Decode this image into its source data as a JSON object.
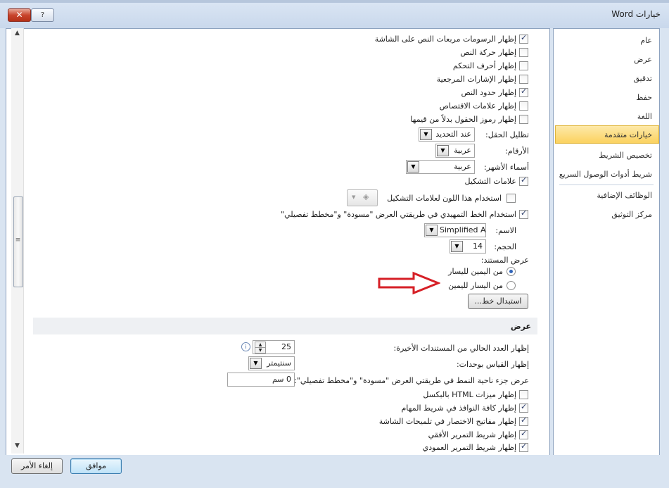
{
  "window": {
    "title": "خيارات Word",
    "close_label": "✕",
    "help_label": "?"
  },
  "nav": {
    "items": [
      {
        "label": "عام"
      },
      {
        "label": "عرض"
      },
      {
        "label": "تدقيق"
      },
      {
        "label": "حفظ"
      },
      {
        "label": "اللغة"
      },
      {
        "label": "خيارات متقدمة",
        "selected": true
      },
      {
        "label": "تخصيص الشريط"
      },
      {
        "label": "شريط أدوات الوصول السريع"
      },
      {
        "label": "الوظائف الإضافية"
      },
      {
        "label": "مركز التوثيق"
      }
    ]
  },
  "content": {
    "checkboxes_top": [
      {
        "label": "إظهار الرسومات مربعات النص على الشاشة",
        "checked": true
      },
      {
        "label": "إظهار حركة النص",
        "checked": false
      },
      {
        "label": "إظهار أحرف التحكم",
        "checked": false
      },
      {
        "label": "إظهار الإشارات المرجعية",
        "checked": false
      },
      {
        "label": "إظهار حدود النص",
        "checked": true
      },
      {
        "label": "إظهار علامات الاقتصاص",
        "checked": false
      },
      {
        "label": "إظهار رموز الحقول بدلاً من قيمها",
        "checked": false
      }
    ],
    "field_shading": {
      "label": "تظليل الحقل:",
      "value": "عند التحديد"
    },
    "numerals": {
      "label": "الأرقام:",
      "value": "عربية"
    },
    "month_names": {
      "label": "أسماء الأشهر:",
      "value": "عربية"
    },
    "diacritics": {
      "label": "علامات التشكيل",
      "checked": true
    },
    "diacritics_color": {
      "label": "استخدام هذا اللون لعلامات التشكيل",
      "checked": false
    },
    "draft_font": {
      "label": "استخدام الخط التمهيدي في طريقتي العرض \"مسودة\" و\"مخطط تفصيلي\"",
      "checked": true
    },
    "font_name": {
      "label": "الاسم:",
      "value": "Simplified Ara"
    },
    "font_size": {
      "label": "الحجم:",
      "value": "14"
    },
    "doc_view": {
      "label": "عرض المستند:",
      "options": [
        {
          "label": "من اليمين لليسار",
          "selected": true
        },
        {
          "label": "من اليسار لليمين",
          "selected": false
        }
      ]
    },
    "font_substitution_button": "استبدال خط...",
    "display_section": {
      "title": "عرض",
      "recent_docs": {
        "label": "إظهار العدد الحالي من المستندات الأخيرة:",
        "value": "25"
      },
      "measure_units": {
        "label": "إظهار القياس بوحدات:",
        "value": "سنتيمتر"
      },
      "style_pane_width": {
        "label": "عرض جزء ناحية النمط في طريقتي العرض \"مسودة\" و\"مخطط تفصيلي\":",
        "value": "0 سم"
      },
      "checkboxes": [
        {
          "label": "إظهار ميزات HTML بالبكسل",
          "checked": false
        },
        {
          "label": "إظهار كافة النوافذ في شريط المهام",
          "checked": true
        },
        {
          "label": "إظهار مفاتيح الاختصار في تلميحات الشاشة",
          "checked": true
        },
        {
          "label": "إظهار شريط التمرير الأفقي",
          "checked": true
        },
        {
          "label": "إظهار شريط التمرير العمودي",
          "checked": true
        }
      ]
    }
  },
  "footer": {
    "ok_label": "موافق",
    "cancel_label": "إلغاء الأمر"
  },
  "colors": {
    "accent_selected": "#fbd25f",
    "annotation_arrow": "#d61f26"
  }
}
